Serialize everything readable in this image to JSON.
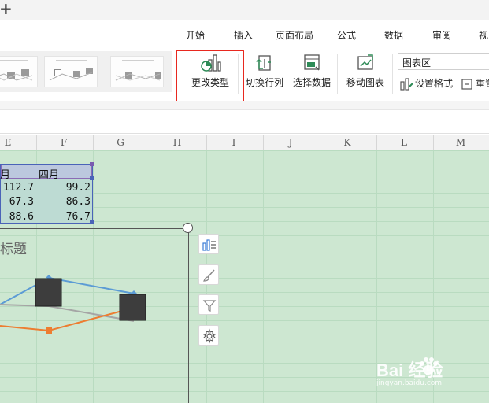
{
  "menu": {
    "tabs": [
      {
        "label": "开始"
      },
      {
        "label": "插入"
      },
      {
        "label": "页面布局"
      },
      {
        "label": "公式"
      },
      {
        "label": "数据"
      },
      {
        "label": "审阅"
      },
      {
        "label": "视"
      }
    ]
  },
  "ribbon": {
    "change_type": "更改类型",
    "switch_row_col": "切换行列",
    "select_data": "选择数据",
    "move_chart": "移动图表",
    "chart_area_select": "图表区",
    "set_format": "设置格式",
    "reset": "重置"
  },
  "columns": [
    "E",
    "F",
    "G",
    "H",
    "I",
    "J",
    "K",
    "L",
    "M"
  ],
  "table": {
    "headers": [
      "月",
      "四月"
    ],
    "rows": [
      [
        "112.7",
        "99.2"
      ],
      [
        "67.3",
        "86.3"
      ],
      [
        "88.6",
        "76.7"
      ]
    ]
  },
  "chart": {
    "title": "标题"
  },
  "colors": {
    "highlight": "#e8281f",
    "sheet_bg": "#cde7d1",
    "series_blue": "#5b9bd5",
    "series_orange": "#ed7d31",
    "series_gray": "#a5a5a5"
  },
  "side_tools": [
    "chart-elements-icon",
    "chart-style-icon",
    "chart-filter-icon",
    "chart-settings-icon"
  ],
  "watermark": {
    "text": "Bai  经验",
    "url": "jingyan.baidu.com"
  }
}
